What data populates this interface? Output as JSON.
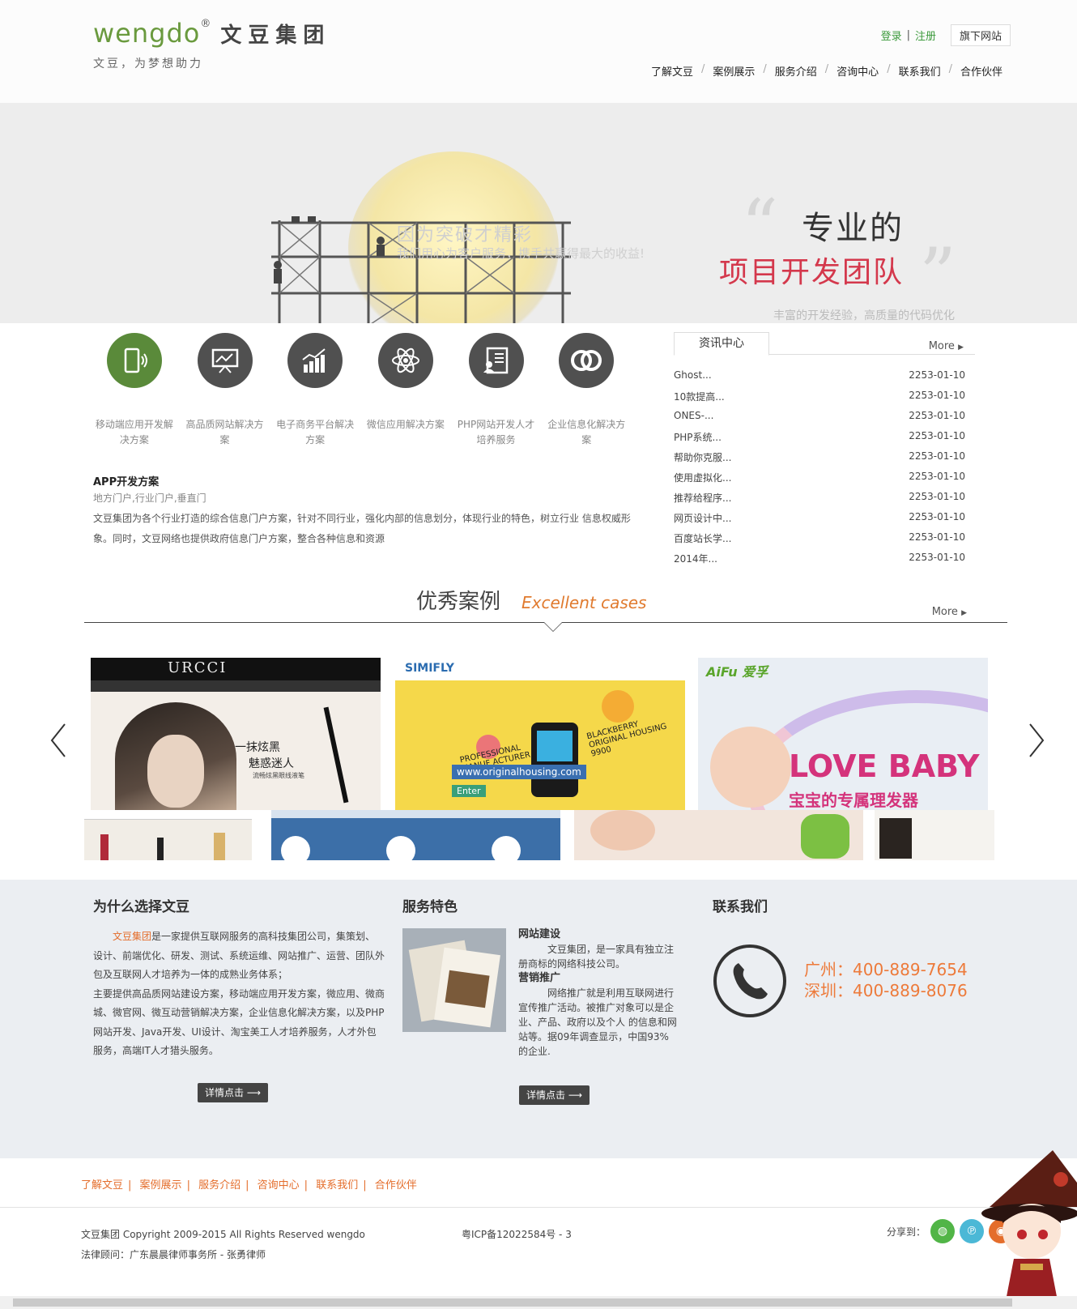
{
  "header": {
    "logo_en": "wengdo",
    "logo_reg": "®",
    "logo_cn": "文豆集团",
    "slogan": "文豆，为梦想助力",
    "login": "登录",
    "sep": "|",
    "register": "注册",
    "subsite": "旗下网站"
  },
  "nav": [
    "了解文豆",
    "案例展示",
    "服务介绍",
    "咨询中心",
    "联系我们",
    "合作伙伴"
  ],
  "nav_sep": "/",
  "banner": {
    "line1": "专业的",
    "line2": "项目开发团队",
    "dim1": "因为突破才精彩",
    "dim2": "我们用心为客户服务，携手共赢得最大的收益!",
    "bottom": "丰富的开发经验，高质量的代码优化"
  },
  "services": {
    "items": [
      {
        "label": "移动端应用开发解决方案",
        "icon": "mobile-icon"
      },
      {
        "label": "高品质网站解决方案",
        "icon": "presentation-icon"
      },
      {
        "label": "电子商务平台解决方案",
        "icon": "chart-icon"
      },
      {
        "label": "微信应用解决方案",
        "icon": "atom-icon"
      },
      {
        "label": "PHP网站开发人才培养服务",
        "icon": "document-person-icon"
      },
      {
        "label": "企业信息化解决方案",
        "icon": "rings-icon"
      }
    ],
    "title": "APP开发方案",
    "subtitle": "地方门户,行业门户,垂直门",
    "desc": "文豆集团为各个行业打造的综合信息门户方案，针对不同行业，强化内部的信息划分，体现行业的特色，树立行业 信息权威形象。同时，文豆网络也提供政府信息门户方案，整合各种信息和资源"
  },
  "news": {
    "tab": "资讯中心",
    "more": "More",
    "items": [
      {
        "title": "Ghost...",
        "date": "2253-01-10"
      },
      {
        "title": "10款提高...",
        "date": "2253-01-10"
      },
      {
        "title": "ONES-...",
        "date": "2253-01-10"
      },
      {
        "title": "PHP系统...",
        "date": "2253-01-10"
      },
      {
        "title": "帮助你克服...",
        "date": "2253-01-10"
      },
      {
        "title": "使用虚拟化...",
        "date": "2253-01-10"
      },
      {
        "title": "推荐给程序...",
        "date": "2253-01-10"
      },
      {
        "title": "网页设计中...",
        "date": "2253-01-10"
      },
      {
        "title": "百度站长学...",
        "date": "2253-01-10"
      },
      {
        "title": "2014年...",
        "date": "2253-01-10"
      }
    ]
  },
  "cases": {
    "title": "优秀案例",
    "en": "Excellent cases",
    "more": "More",
    "c1_brand": "URCCI",
    "c1_line1": "一抹炫黑",
    "c1_line2": "魅惑迷人",
    "c1_line3": "流畅炫黑眼线液笔",
    "c2_brand": "SIMIFLY",
    "c2_t1": "PROFESSIONAL MANUF ACTURER",
    "c2_t2": "BLACKBERRY ORIGINAL HOUSING 9900",
    "c2_url": "www.originalhousing.com",
    "c2_btn": "Enter",
    "c3_brand": "AiFu 爱孚",
    "c3_t1": "LOVE BABY",
    "c3_t2": "宝宝的专属理发器"
  },
  "why": {
    "title": "为什么选择文豆",
    "hl": "文豆集团",
    "p1": "是一家提供互联网服务的高科技集团公司，集策划、设计、前端优化、研发、测试、系统运维、网站推广、运营、团队外包及互联网人才培养为一体的成熟业务体系；",
    "p2": "主要提供高品质网站建设方案，移动端应用开发方案，微应用、微商城、微官网、微互动营销解决方案，企业信息化解决方案，以及PHP网站开发、Java开发、UI设计、淘宝美工人才培养服务，人才外包服务，高端IT人才猎头服务。",
    "btn": "详情点击 ⟶"
  },
  "features": {
    "title": "服务特色",
    "h1": "网站建设",
    "p1": "文豆集团，是一家具有独立注册商标的网络科技公司。",
    "h2": "营销推广",
    "p2": "网络推广就是利用互联网进行宣传推广活动。被推广对象可以是企业、产品、政府以及个人 的信息和网站等。据09年调查显示，中国93% 的企业.",
    "btn": "详情点击 ⟶"
  },
  "contact": {
    "title": "联系我们",
    "gz": "广州：400-889-7654",
    "sz": "深圳：400-889-8076"
  },
  "footer": {
    "links": [
      "了解文豆",
      "案例展示",
      "服务介绍",
      "咨询中心",
      "联系我们",
      "合作伙伴"
    ],
    "copyright": "文豆集团 Copyright 2009-2015 All Rights Reserved wengdo",
    "legal": "法律顾问：广东晨晨律师事务所 - 张勇律师",
    "icp": "粤ICP备12022584号 - 3",
    "share": "分享到："
  },
  "colors": {
    "green": "#5a8a3a",
    "orange": "#e46d2b",
    "red": "#d4384c"
  }
}
